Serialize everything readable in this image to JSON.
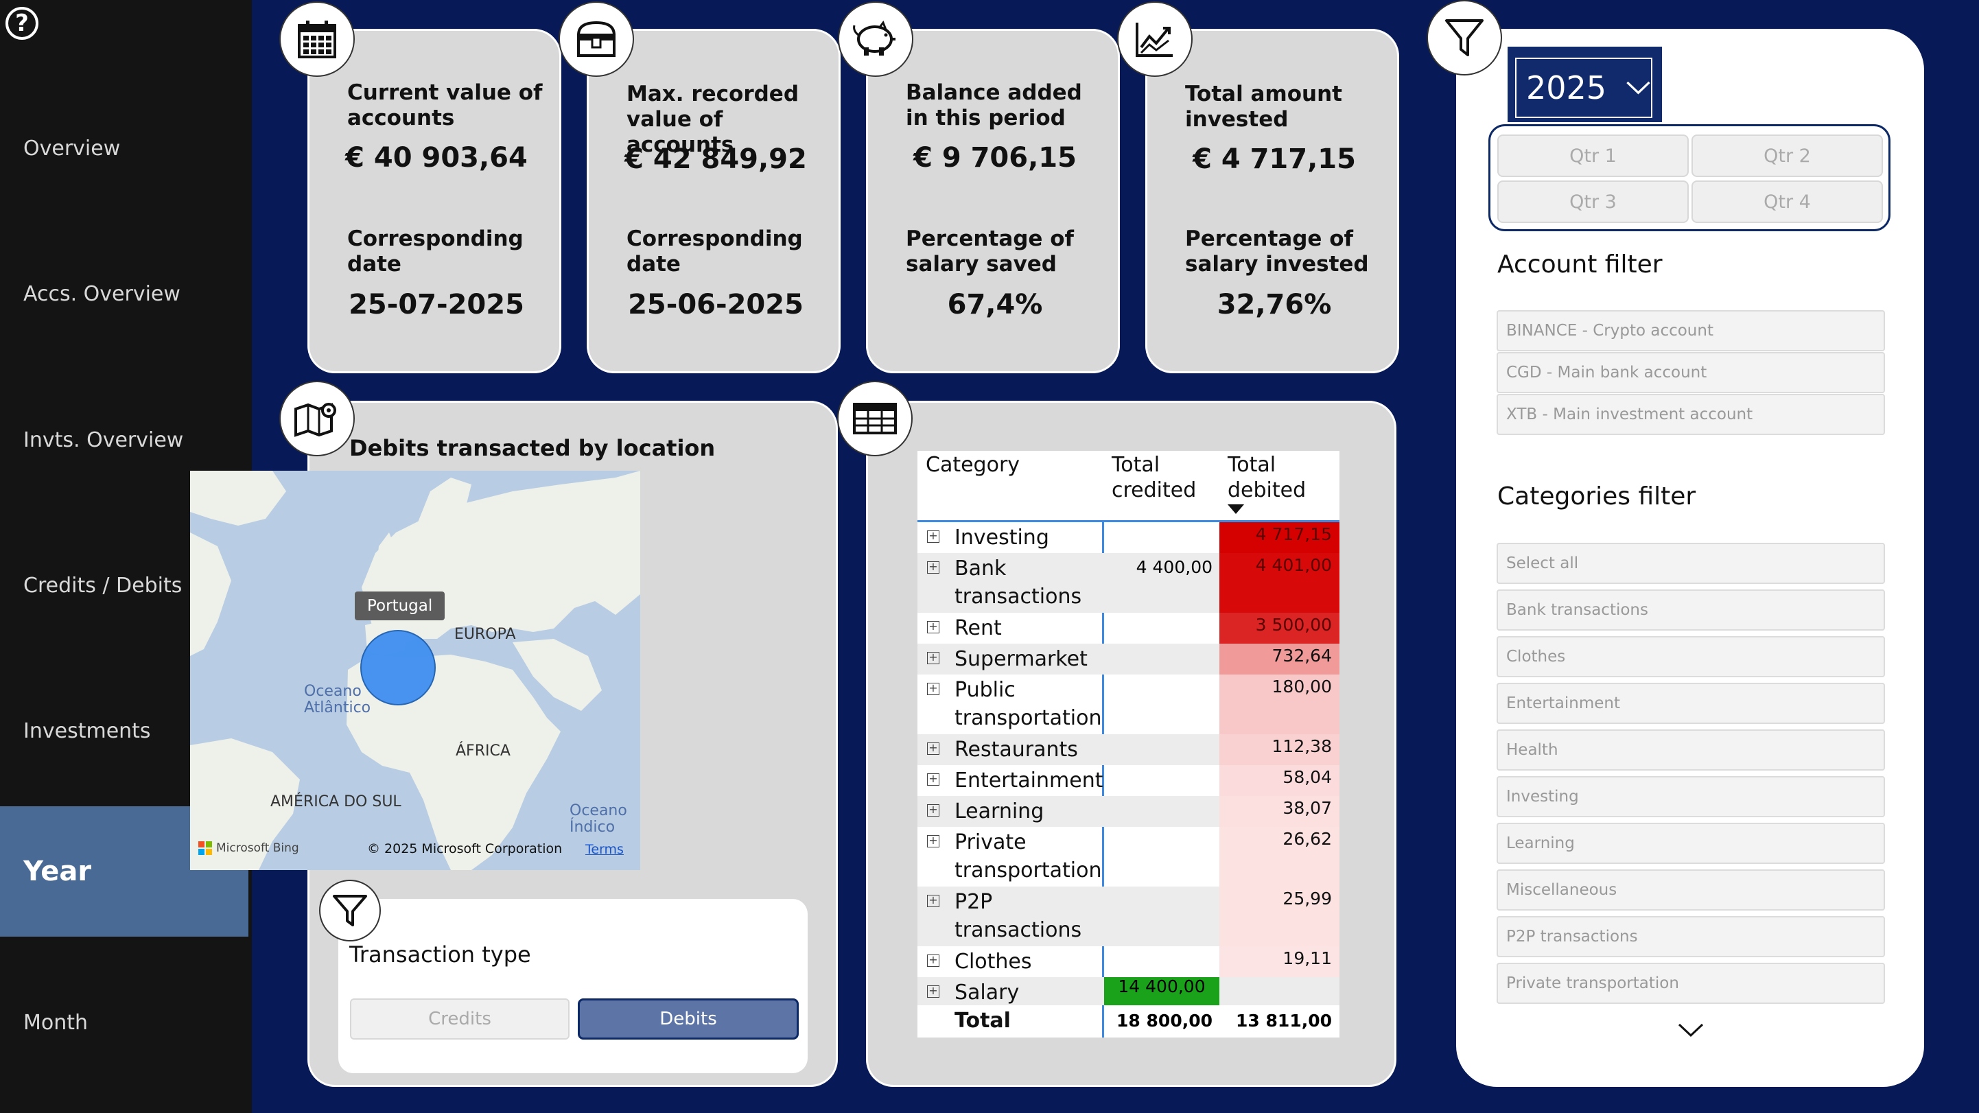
{
  "sidebar": {
    "items": [
      {
        "label": "Overview"
      },
      {
        "label": "Accs. Overview"
      },
      {
        "label": "Invts. Overview"
      },
      {
        "label": "Credits / Debits"
      },
      {
        "label": "Investments"
      },
      {
        "label": "Year"
      },
      {
        "label": "Month"
      }
    ],
    "active": "Year"
  },
  "kpis": [
    {
      "label": "Current value of accounts",
      "value": "€ 40 903,64",
      "sub_label": "Corresponding date",
      "sub_value": "25-07-2025",
      "icon": "calendar-icon"
    },
    {
      "label": "Max. recorded value of accounts",
      "value": "€ 42 849,92",
      "sub_label": "Corresponding date",
      "sub_value": "25-06-2025",
      "icon": "treasure-chest-icon"
    },
    {
      "label": "Balance added in this period",
      "value": "€ 9 706,15",
      "sub_label": "Percentage of salary saved",
      "sub_value": "67,4%",
      "icon": "piggy-bank-icon"
    },
    {
      "label": "Total amount invested",
      "value": "€ 4 717,15",
      "sub_label": "Percentage of salary invested",
      "sub_value": "32,76%",
      "icon": "line-chart-icon"
    }
  ],
  "map": {
    "title": "Debits transacted by location",
    "tooltip": "Portugal",
    "labels": {
      "europa": "EUROPA",
      "africa": "ÁFRICA",
      "america": "AMÉRICA DO SUL",
      "ocean_atl_1": "Oceano",
      "ocean_atl_2": "Atlântico",
      "ocean_ind_1": "Oceano",
      "ocean_ind_2": "Índico"
    },
    "bing": "Microsoft Bing",
    "copyright": "© 2025 Microsoft Corporation",
    "terms": "Terms"
  },
  "transaction_type": {
    "title": "Transaction type",
    "options": [
      "Credits",
      "Debits"
    ],
    "selected": "Debits"
  },
  "table": {
    "headers": {
      "category": "Category",
      "credited_1": "Total",
      "credited_2": "credited",
      "debited_1": "Total",
      "debited_2": "debited"
    },
    "rows": [
      {
        "cat1": "Investing",
        "cat2": "",
        "credited": "",
        "debited": "4 717,15",
        "debited_value": 4717.15
      },
      {
        "cat1": "Bank",
        "cat2": "transactions",
        "credited": "4 400,00",
        "debited": "4 401,00",
        "debited_value": 4401.0
      },
      {
        "cat1": "Rent",
        "cat2": "",
        "credited": "",
        "debited": "3 500,00",
        "debited_value": 3500.0
      },
      {
        "cat1": "Supermarket",
        "cat2": "",
        "credited": "",
        "debited": "732,64",
        "debited_value": 732.64
      },
      {
        "cat1": "Public",
        "cat2": "transportation",
        "credited": "",
        "debited": "180,00",
        "debited_value": 180.0
      },
      {
        "cat1": "Restaurants",
        "cat2": "",
        "credited": "",
        "debited": "112,38",
        "debited_value": 112.38
      },
      {
        "cat1": "Entertainment",
        "cat2": "",
        "credited": "",
        "debited": "58,04",
        "debited_value": 58.04
      },
      {
        "cat1": "Learning",
        "cat2": "",
        "credited": "",
        "debited": "38,07",
        "debited_value": 38.07
      },
      {
        "cat1": "Private",
        "cat2": "transportation",
        "credited": "",
        "debited": "26,62",
        "debited_value": 26.62
      },
      {
        "cat1": "P2P",
        "cat2": "transactions",
        "credited": "",
        "debited": "25,99",
        "debited_value": 25.99
      },
      {
        "cat1": "Clothes",
        "cat2": "",
        "credited": "",
        "debited": "19,11",
        "debited_value": 19.11
      },
      {
        "cat1": "Salary",
        "cat2": "",
        "credited": "14 400,00",
        "debited": "",
        "debited_value": 0
      }
    ],
    "total": {
      "label": "Total",
      "credited": "18 800,00",
      "debited": "13 811,00"
    },
    "colors": {
      "debit_high": "#d50000",
      "credit_high": "#1aa31a"
    }
  },
  "filters": {
    "year": "2025",
    "quarters": [
      "Qtr 1",
      "Qtr 2",
      "Qtr 3",
      "Qtr 4"
    ],
    "account_title": "Account filter",
    "accounts": [
      "BINANCE - Crypto account",
      "CGD - Main bank account",
      "XTB - Main investment account"
    ],
    "categories_title": "Categories filter",
    "categories": [
      "Select all",
      "Bank transactions",
      "Clothes",
      "Entertainment",
      "Health",
      "Investing",
      "Learning",
      "Miscellaneous",
      "P2P transactions",
      "Private transportation"
    ]
  },
  "colors": {
    "background": "#071a57",
    "sidebar": "#141414",
    "active_nav": "#4a6a96",
    "card": "#d9d9d9",
    "year_box": "#102a6b"
  }
}
